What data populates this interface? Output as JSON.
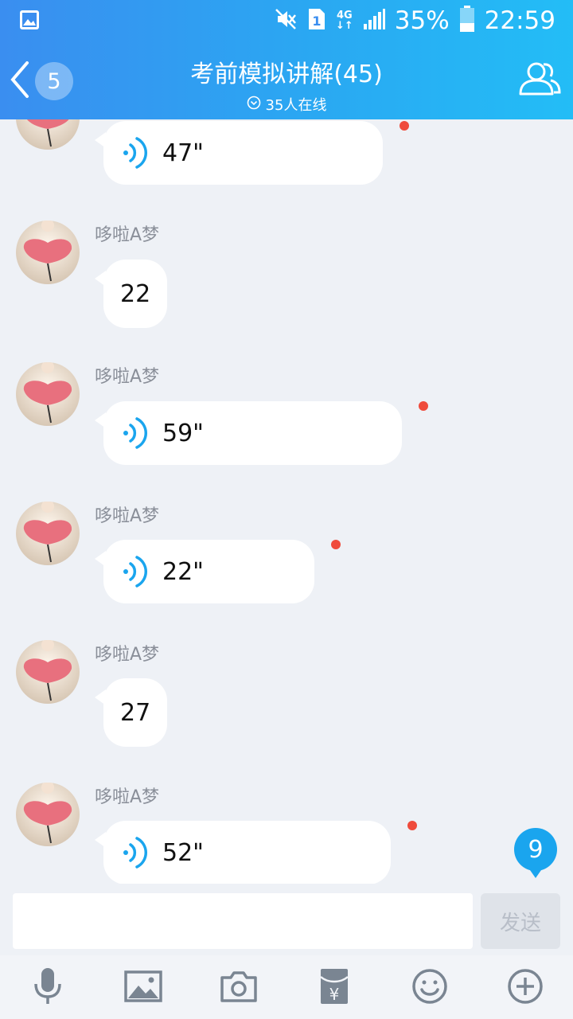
{
  "status_bar": {
    "network": "4G",
    "sim": "1",
    "battery": "35%",
    "time": "22:59"
  },
  "header": {
    "back_badge": "5",
    "title": "考前模拟讲解(45)",
    "subtitle": "35人在线"
  },
  "messages": [
    {
      "sender": "",
      "type": "voice",
      "duration": "47\"",
      "unread": true
    },
    {
      "sender": "哆啦A梦",
      "type": "text",
      "text": "22"
    },
    {
      "sender": "哆啦A梦",
      "type": "voice",
      "duration": "59\"",
      "unread": true
    },
    {
      "sender": "哆啦A梦",
      "type": "voice",
      "duration": "22\"",
      "unread": true
    },
    {
      "sender": "哆啦A梦",
      "type": "text",
      "text": "27"
    },
    {
      "sender": "哆啦A梦",
      "type": "voice",
      "duration": "52\"",
      "unread": true
    }
  ],
  "new_messages_badge": "9",
  "input": {
    "value": "",
    "placeholder": "",
    "send_label": "发送"
  },
  "toolbar": [
    "mic-icon",
    "image-icon",
    "camera-icon",
    "red-packet-icon",
    "emoji-icon",
    "plus-icon"
  ],
  "colors": {
    "header_start": "#3a8ef0",
    "header_end": "#23bdf6",
    "unread_dot": "#ef4b3c",
    "voice_wave": "#1aa5ee",
    "background": "#eef1f6"
  }
}
